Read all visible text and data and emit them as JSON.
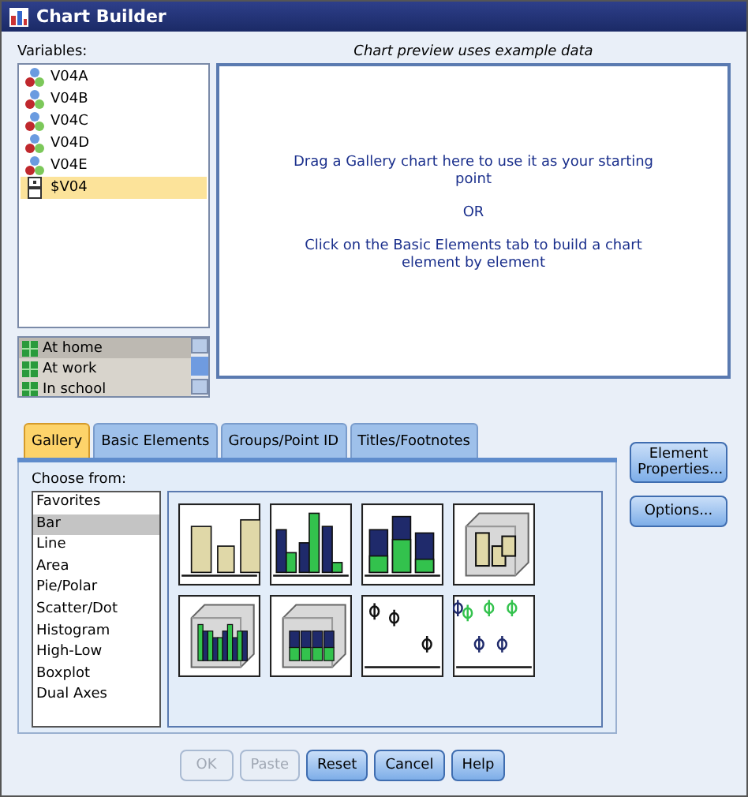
{
  "window": {
    "title": "Chart Builder"
  },
  "variables": {
    "label": "Variables:",
    "items": [
      {
        "name": "V04A",
        "kind": "nominal",
        "selected": false
      },
      {
        "name": "V04B",
        "kind": "nominal",
        "selected": false
      },
      {
        "name": "V04C",
        "kind": "nominal",
        "selected": false
      },
      {
        "name": "V04D",
        "kind": "nominal",
        "selected": false
      },
      {
        "name": "V04E",
        "kind": "nominal",
        "selected": false
      },
      {
        "name": "$V04",
        "kind": "multiset",
        "selected": true
      }
    ]
  },
  "categories": [
    {
      "name": "At home",
      "selected": true
    },
    {
      "name": "At work",
      "selected": false
    },
    {
      "name": "In school",
      "selected": false
    }
  ],
  "preview": {
    "caption": "Chart preview uses example data",
    "messages": [
      "Drag a Gallery chart here to use it as your starting point",
      "OR",
      "Click on the Basic Elements tab to build a chart element by element"
    ]
  },
  "tabs": [
    {
      "label": "Gallery",
      "selected": true
    },
    {
      "label": "Basic Elements",
      "selected": false
    },
    {
      "label": "Groups/Point ID",
      "selected": false
    },
    {
      "label": "Titles/Footnotes",
      "selected": false
    }
  ],
  "gallery": {
    "label": "Choose from:",
    "types": [
      {
        "label": "Favorites",
        "selected": false
      },
      {
        "label": "Bar",
        "selected": true
      },
      {
        "label": "Line",
        "selected": false
      },
      {
        "label": "Area",
        "selected": false
      },
      {
        "label": "Pie/Polar",
        "selected": false
      },
      {
        "label": "Scatter/Dot",
        "selected": false
      },
      {
        "label": "Histogram",
        "selected": false
      },
      {
        "label": "High-Low",
        "selected": false
      },
      {
        "label": "Boxplot",
        "selected": false
      },
      {
        "label": "Dual Axes",
        "selected": false
      }
    ],
    "thumbnails": [
      {
        "kind": "simple"
      },
      {
        "kind": "clustered"
      },
      {
        "kind": "stacked"
      },
      {
        "kind": "simple3d"
      },
      {
        "kind": "clustered3d"
      },
      {
        "kind": "stacked3d"
      },
      {
        "kind": "errorbar"
      },
      {
        "kind": "clustered-errorbar"
      }
    ]
  },
  "side_buttons": [
    "Element Properties...",
    "Options..."
  ],
  "buttons": [
    {
      "label": "OK",
      "disabled": true
    },
    {
      "label": "Paste",
      "disabled": true
    },
    {
      "label": "Reset",
      "disabled": false
    },
    {
      "label": "Cancel",
      "disabled": false
    },
    {
      "label": "Help",
      "disabled": false
    }
  ]
}
